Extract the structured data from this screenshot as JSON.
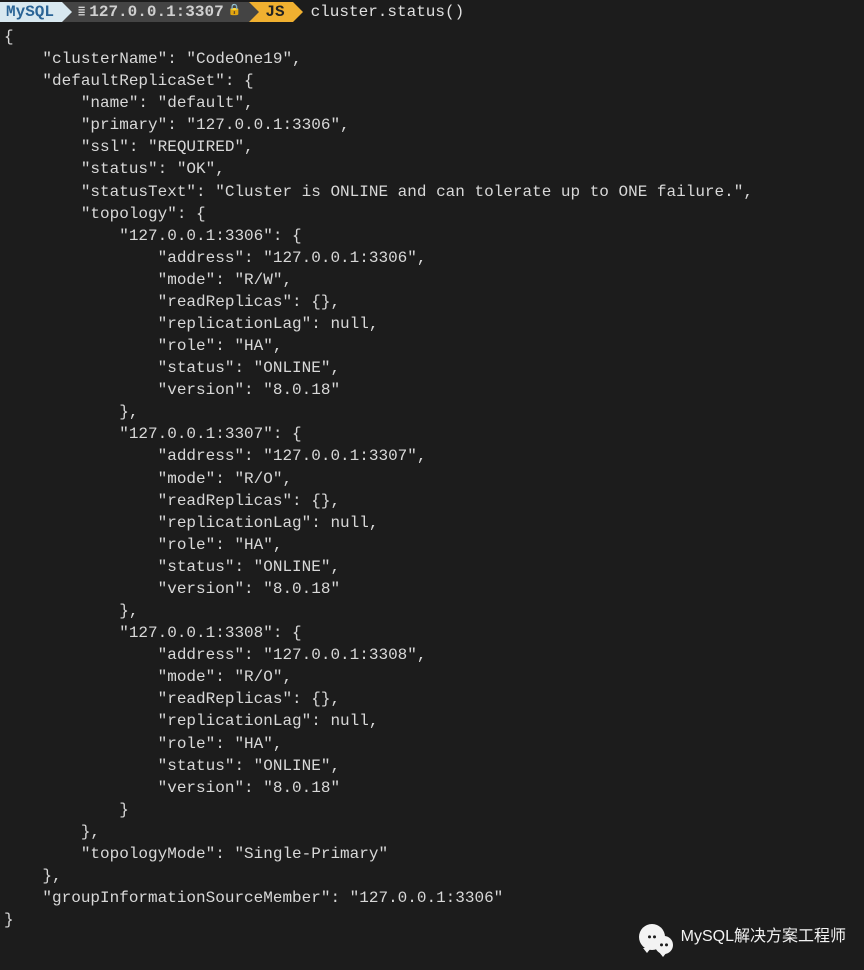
{
  "prompt": {
    "mysql_label": "MySQL",
    "host": "127.0.0.1:3307",
    "lang_label": "JS",
    "command": "cluster.status()"
  },
  "output": {
    "clusterName": "CodeOne19",
    "defaultReplicaSet": {
      "name": "default",
      "primary": "127.0.0.1:3306",
      "ssl": "REQUIRED",
      "status": "OK",
      "statusText": "Cluster is ONLINE and can tolerate up to ONE failure.",
      "topology": {
        "127.0.0.1:3306": {
          "address": "127.0.0.1:3306",
          "mode": "R/W",
          "readReplicas": {},
          "replicationLag": null,
          "role": "HA",
          "status": "ONLINE",
          "version": "8.0.18"
        },
        "127.0.0.1:3307": {
          "address": "127.0.0.1:3307",
          "mode": "R/O",
          "readReplicas": {},
          "replicationLag": null,
          "role": "HA",
          "status": "ONLINE",
          "version": "8.0.18"
        },
        "127.0.0.1:3308": {
          "address": "127.0.0.1:3308",
          "mode": "R/O",
          "readReplicas": {},
          "replicationLag": null,
          "role": "HA",
          "status": "ONLINE",
          "version": "8.0.18"
        }
      },
      "topologyMode": "Single-Primary"
    },
    "groupInformationSourceMember": "127.0.0.1:3306"
  },
  "watermark": {
    "text": "MySQL解决方案工程师"
  }
}
